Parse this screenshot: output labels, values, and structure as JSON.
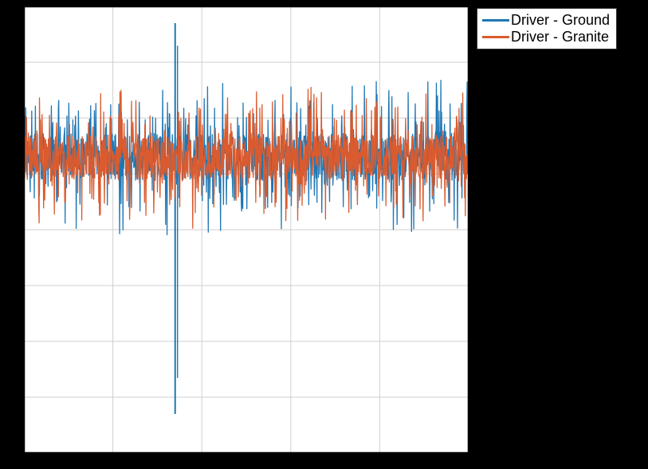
{
  "chart_data": {
    "type": "line",
    "title": "",
    "xlabel": "",
    "ylabel": "",
    "xlim": [
      0,
      500
    ],
    "ylim": [
      -2.5,
      1.5
    ],
    "xticks": [
      0,
      100,
      200,
      300,
      400,
      500
    ],
    "yticks": [
      -2.5,
      -2.0,
      -1.5,
      -1.0,
      -0.5,
      0.0,
      0.5,
      1.0,
      1.5
    ],
    "grid": true,
    "legend_position": "outside-top-right",
    "series": [
      {
        "name": "Driver - Ground",
        "color": "#1f77b4",
        "noise_mean": 0.15,
        "noise_band": [
          -0.55,
          0.85
        ],
        "spikes": [
          {
            "x": 170,
            "ymin": -2.15,
            "ymax": 1.35
          }
        ]
      },
      {
        "name": "Driver - Granite",
        "color": "#d95b2f",
        "noise_mean": 0.15,
        "noise_band": [
          -0.5,
          0.8
        ],
        "spikes": []
      }
    ]
  },
  "legend": {
    "items": [
      {
        "label": "Driver - Ground",
        "color": "#1f77b4"
      },
      {
        "label": "Driver - Granite",
        "color": "#d95b2f"
      }
    ]
  }
}
